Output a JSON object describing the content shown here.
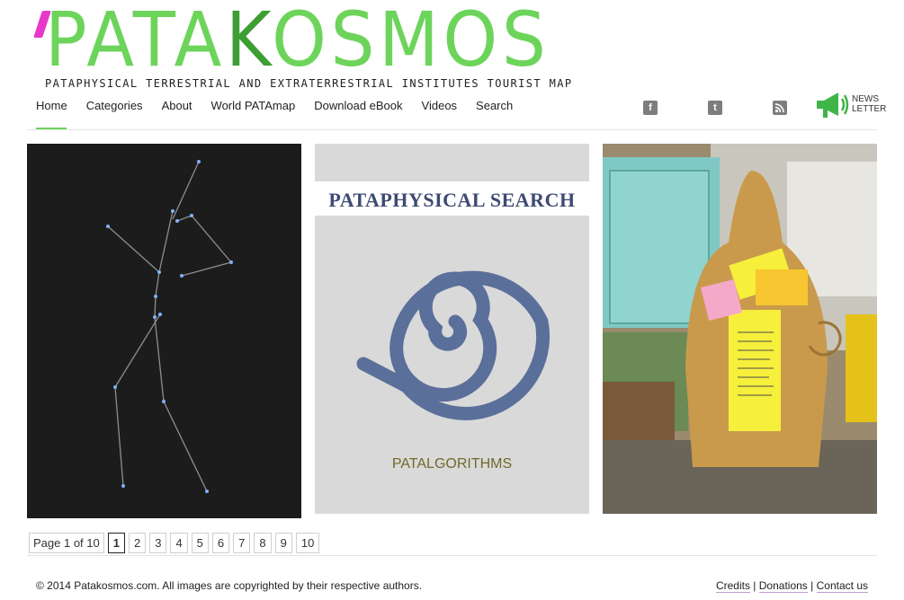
{
  "logo": {
    "word_part1": "PATA",
    "word_part2": "K",
    "word_part3": "OSMOS",
    "tagline": "PATAPHYSICAL TERRESTRIAL AND EXTRATERRESTRIAL INSTITUTES TOURIST MAP"
  },
  "nav": {
    "items": [
      "Home",
      "Categories",
      "About",
      "World PATAmap",
      "Download eBook",
      "Videos",
      "Search"
    ],
    "active": "Home"
  },
  "social": {
    "facebook": "f",
    "twitter": "t",
    "rss_icon": "rss-icon",
    "newsletter_line1": "NEWS",
    "newsletter_line2": "LETTER"
  },
  "tiles": {
    "search_title": "PATAPHYSICAL SEARCH",
    "search_caption": "PATALGORITHMS"
  },
  "pagination": {
    "label": "Page 1 of 10",
    "current": "1",
    "pages": [
      "2",
      "3",
      "4",
      "5",
      "6",
      "7",
      "8",
      "9",
      "10"
    ]
  },
  "footer": {
    "copyright": "© 2014 Patakosmos.com. All images are copyrighted by their respective authors.",
    "credits": "Credits",
    "donations": "Donations",
    "contact": "Contact us",
    "sep": "|"
  },
  "colors": {
    "logo_green": "#6dd45b",
    "logo_dark_green": "#3c9e33",
    "apostrophe_pink": "#e838c8",
    "spiral_blue": "#5a6f99"
  }
}
